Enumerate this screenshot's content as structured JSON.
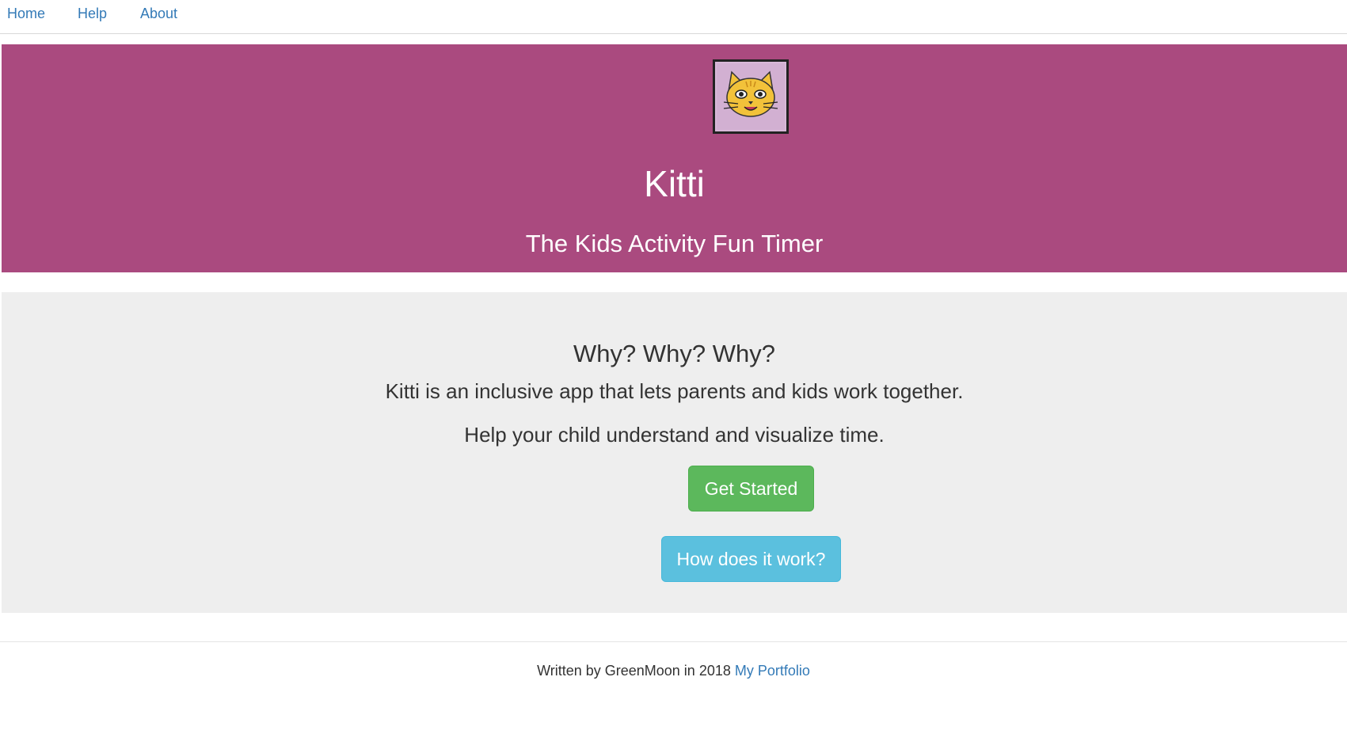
{
  "nav": {
    "items": [
      {
        "label": "Home"
      },
      {
        "label": "Help"
      },
      {
        "label": "About"
      }
    ]
  },
  "hero": {
    "logo_icon": "cat-face-icon",
    "title": "Kitti",
    "subtitle": "The Kids Activity Fun Timer",
    "background_color": "#aa4a7f"
  },
  "intro": {
    "heading": "Why? Why? Why?",
    "line1": "Kitti is an inclusive app that lets parents and kids work together.",
    "line2": "Help your child understand and visualize time.",
    "get_started_label": "Get Started",
    "how_it_works_label": "How does it work?",
    "background_color": "#eeeeee"
  },
  "footer": {
    "text": "Written by GreenMoon in 2018",
    "link_label": "My Portfolio"
  },
  "colors": {
    "link": "#337ab7",
    "success_button": "#5cb85c",
    "info_button": "#5bc0de"
  }
}
